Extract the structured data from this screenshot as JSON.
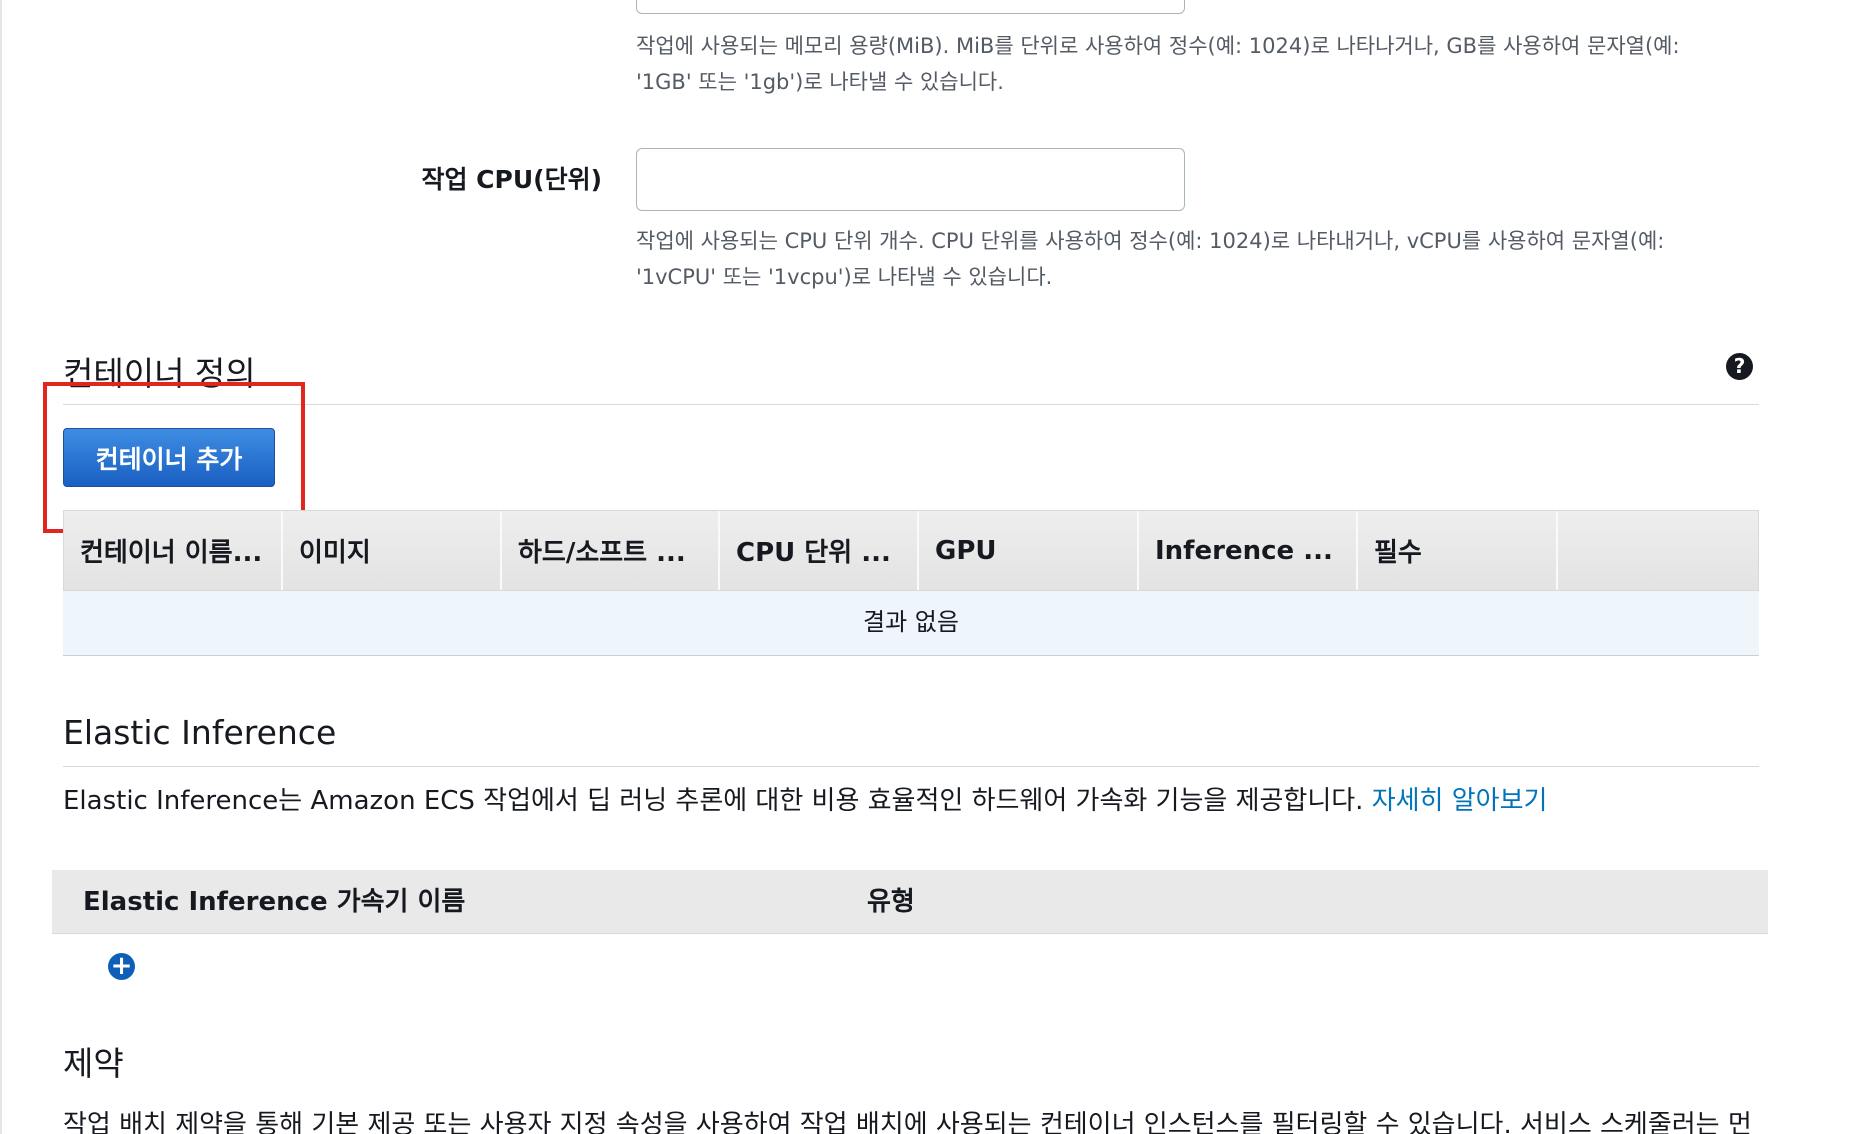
{
  "memory_field": {
    "help_line1": "작업에 사용되는 메모리 용량(MiB). MiB를 단위로 사용하여 정수(예: 1024)로 나타나거나, GB를 사용하여 문자열(예:",
    "help_line2": "'1GB' 또는 '1gb')로 나타낼 수 있습니다.",
    "value": ""
  },
  "cpu_field": {
    "label": "작업 CPU(단위)",
    "value": "",
    "help_line1": "작업에 사용되는 CPU 단위 개수. CPU 단위를 사용하여 정수(예: 1024)로 나타내거나, vCPU를 사용하여 문자열(예:",
    "help_line2": "'1vCPU' 또는 '1vcpu')로 나타낼 수 있습니다."
  },
  "container_section": {
    "title": "컨테이너 정의",
    "help_icon": "question-circle-icon",
    "add_button_label": "컨테이너 추가",
    "table": {
      "columns": [
        "컨테이너 이름...",
        "이미지",
        "하드/소프트 ...",
        "CPU 단위 ...",
        "GPU",
        "Inference ...",
        "필수",
        ""
      ],
      "empty_text": "결과 없음"
    }
  },
  "elastic_inference": {
    "title": "Elastic Inference",
    "description": "Elastic Inference는 Amazon ECS 작업에서 딥 러닝 추론에 대한 비용 효율적인 하드웨어 가속화 기능을 제공합니다.",
    "learn_more": "자세히 알아보기",
    "columns": [
      "Elastic Inference 가속기 이름",
      "유형"
    ],
    "add_icon": "plus-circle-icon"
  },
  "constraints": {
    "title": "제약",
    "description": "작업 배치 제약을 통해 기본 제공 또는 사용자 지정 속성을 사용하여 작업 배치에 사용되는 컨테이너 인스턴스를 필터링할 수 있습니다. 서비스 스케줄러는 먼"
  },
  "colors": {
    "primary_button": "#1a5fc2",
    "link": "#0073bb",
    "highlight": "#e0261f",
    "empty_row_bg": "#eef6fc"
  }
}
